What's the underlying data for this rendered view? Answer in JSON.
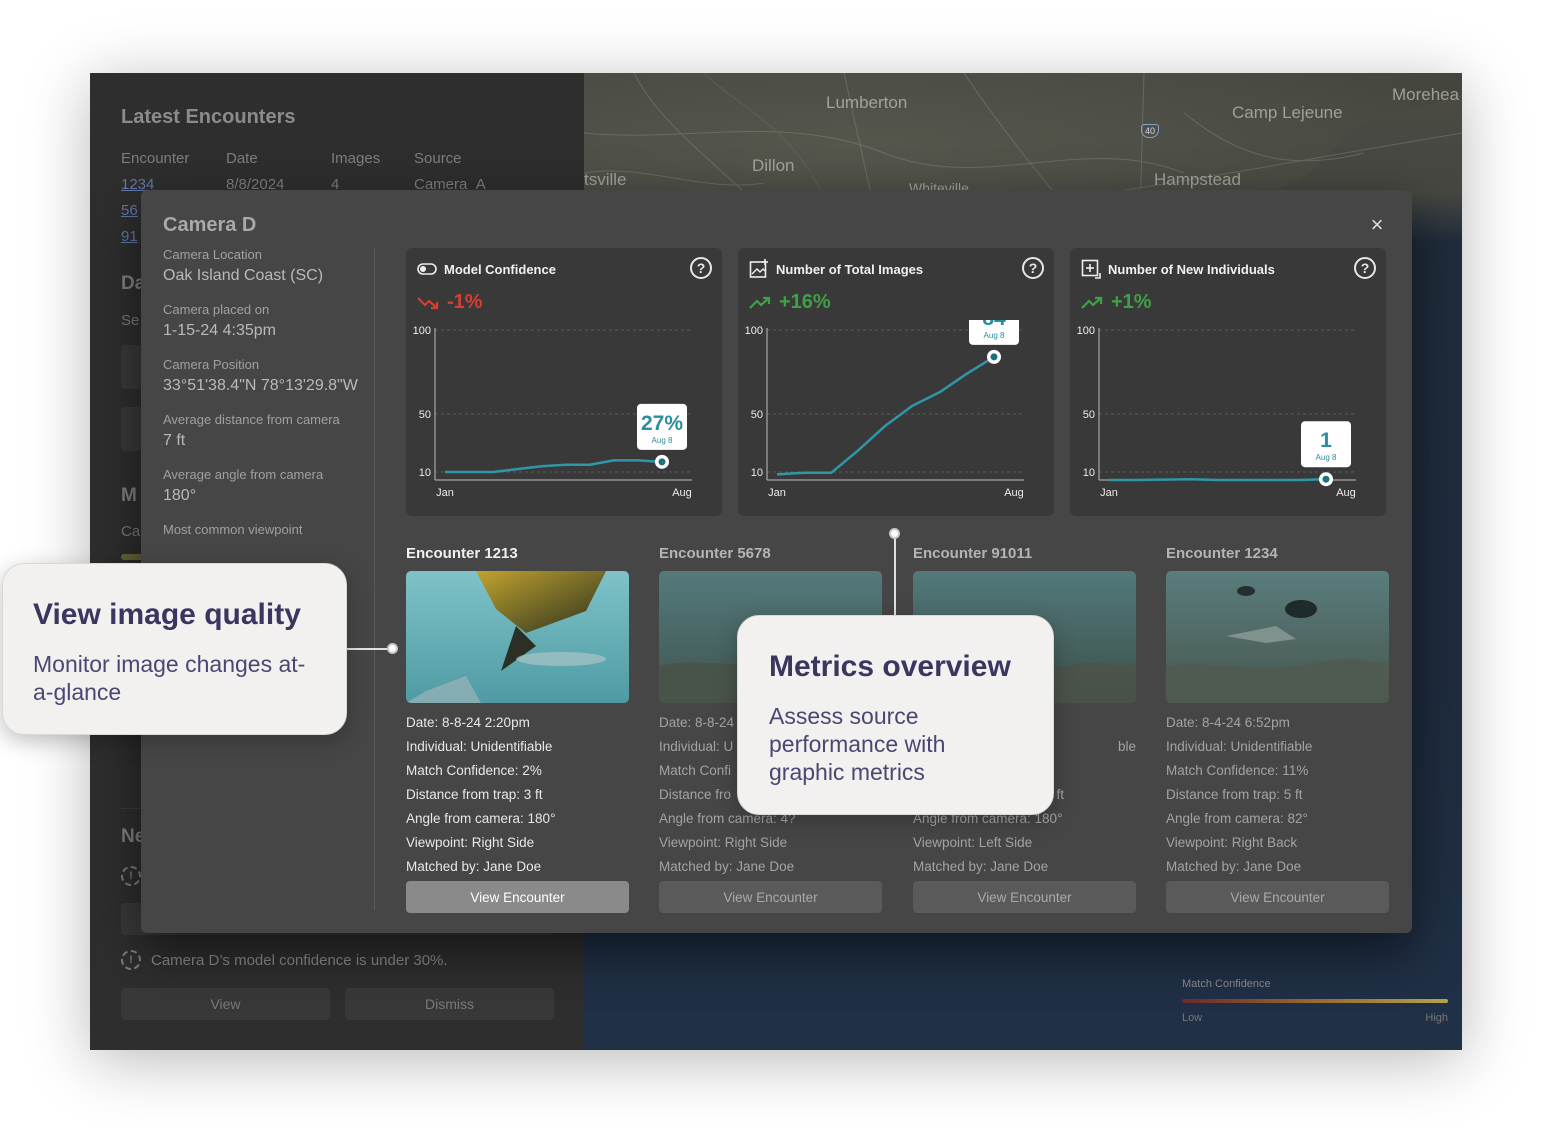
{
  "left_panel": {
    "title": "Latest Encounters",
    "columns": [
      "Encounter",
      "Date",
      "Images",
      "Source"
    ],
    "rows": [
      [
        "1234",
        "8/8/2024",
        "4",
        "Camera_A"
      ],
      [
        "56",
        "",
        "",
        ""
      ],
      [
        "91",
        "",
        "",
        ""
      ]
    ],
    "frag_da": "Da",
    "frag_se": "Se",
    "frag_m": "M",
    "frag_ca": "Ca",
    "frag_ne": "Ne",
    "warning_text": "Camera D’s model confidence is under 30%.",
    "view_button": "View",
    "dismiss_button": "Dismiss"
  },
  "map": {
    "labels": [
      "Lumberton",
      "Camp Lejeune",
      "Morehea",
      "Dillon",
      "tsville",
      "Hampstead",
      "Whiteville"
    ],
    "interstate": "40",
    "legend": {
      "title": "Match Confidence",
      "low": "Low",
      "high": "High"
    }
  },
  "modal": {
    "title": "Camera D",
    "close_icon": "×",
    "info": [
      {
        "label": "Camera Location",
        "value": "Oak Island Coast (SC)"
      },
      {
        "label": "Camera placed on",
        "value": "1-15-24 4:35pm"
      },
      {
        "label": "Camera Position",
        "value": "33°51'38.4\"N 78°13'29.8\"W"
      },
      {
        "label": "Average distance from camera",
        "value": "7 ft"
      },
      {
        "label": "Average angle from camera",
        "value": "180°"
      },
      {
        "label": "Most common viewpoint",
        "value": ""
      }
    ],
    "metrics": [
      {
        "title": "Model Confidence",
        "icon": "toggle-icon",
        "change": "-1%",
        "direction": "down",
        "color": "#d83d2f",
        "tooltip_value": "27%",
        "tooltip_date": "Aug 8",
        "x_start": "Jan",
        "x_end": "Aug",
        "y_ticks": [
          "100",
          "50",
          "10"
        ],
        "chart_data": {
          "type": "line",
          "x": [
            "Jan",
            "",
            "",
            "",
            "",
            "",
            "",
            "",
            "Aug"
          ],
          "values": [
            10,
            10,
            10,
            12,
            14,
            15,
            15,
            18,
            18,
            17
          ],
          "ylim": [
            10,
            100
          ]
        }
      },
      {
        "title": "Number of Total Images",
        "icon": "image-add-icon",
        "change": "+16%",
        "direction": "up",
        "color": "#3fa046",
        "tooltip_value": "84",
        "tooltip_date": "Aug 8",
        "x_start": "Jan",
        "x_end": "Aug",
        "y_ticks": [
          "100",
          "50",
          "10"
        ],
        "chart_data": {
          "type": "line",
          "x": [
            "Jan",
            "",
            "",
            "",
            "",
            "",
            "",
            "",
            "Aug"
          ],
          "values": [
            7,
            9,
            9,
            25,
            42,
            55,
            63,
            74,
            84
          ],
          "ylim": [
            10,
            100
          ]
        }
      },
      {
        "title": "Number of New Individuals",
        "icon": "add-individual-icon",
        "change": "+1%",
        "direction": "up",
        "color": "#3fa046",
        "tooltip_value": "1",
        "tooltip_date": "Aug 8",
        "x_start": "Jan",
        "x_end": "Aug",
        "y_ticks": [
          "100",
          "50",
          "10"
        ],
        "chart_data": {
          "type": "line",
          "x": [
            "Jan",
            "",
            "",
            "",
            "",
            "",
            "",
            "",
            "Aug"
          ],
          "values": [
            0,
            0,
            0.5,
            1,
            0,
            0,
            0,
            0,
            1
          ],
          "ylim": [
            10,
            100
          ]
        }
      }
    ],
    "encounters": [
      {
        "title": "Encounter 1213",
        "details": [
          "Date: 8-8-24 2:20pm",
          "Individual: Unidentifiable",
          "Match Confidence: 2%",
          "Distance from trap: 3 ft",
          "Angle from camera: 180°",
          "Viewpoint: Right Side",
          "Matched by: Jane Doe"
        ],
        "button": "View Encounter"
      },
      {
        "title": "Encounter 5678",
        "details": [
          "Date: 8-8-24",
          "Individual: U",
          "Match Confi",
          "Distance fro",
          "Angle from camera: 4?",
          "Viewpoint: Right Side",
          "Matched by: Jane Doe"
        ],
        "button": "View Encounter"
      },
      {
        "title": "Encounter 91011",
        "details": [
          "",
          "ble",
          "",
          "ft",
          "Angle from camera: 180°",
          "Viewpoint: Left Side",
          "Matched by: Jane Doe"
        ],
        "button": "View Encounter"
      },
      {
        "title": "Encounter 1234",
        "details": [
          "Date: 8-4-24 6:52pm",
          "Individual: Unidentifiable",
          "Match Confidence: 11%",
          "Distance from trap: 5 ft",
          "Angle from camera: 82°",
          "Viewpoint: Right Back",
          "Matched by: Jane Doe"
        ],
        "button": "View Encounter"
      }
    ]
  },
  "callouts": {
    "image_quality": {
      "title": "View image quality",
      "text": "Monitor image changes at-a-glance"
    },
    "metrics": {
      "title": "Metrics overview",
      "text": "Assess source performance with graphic metrics"
    }
  }
}
